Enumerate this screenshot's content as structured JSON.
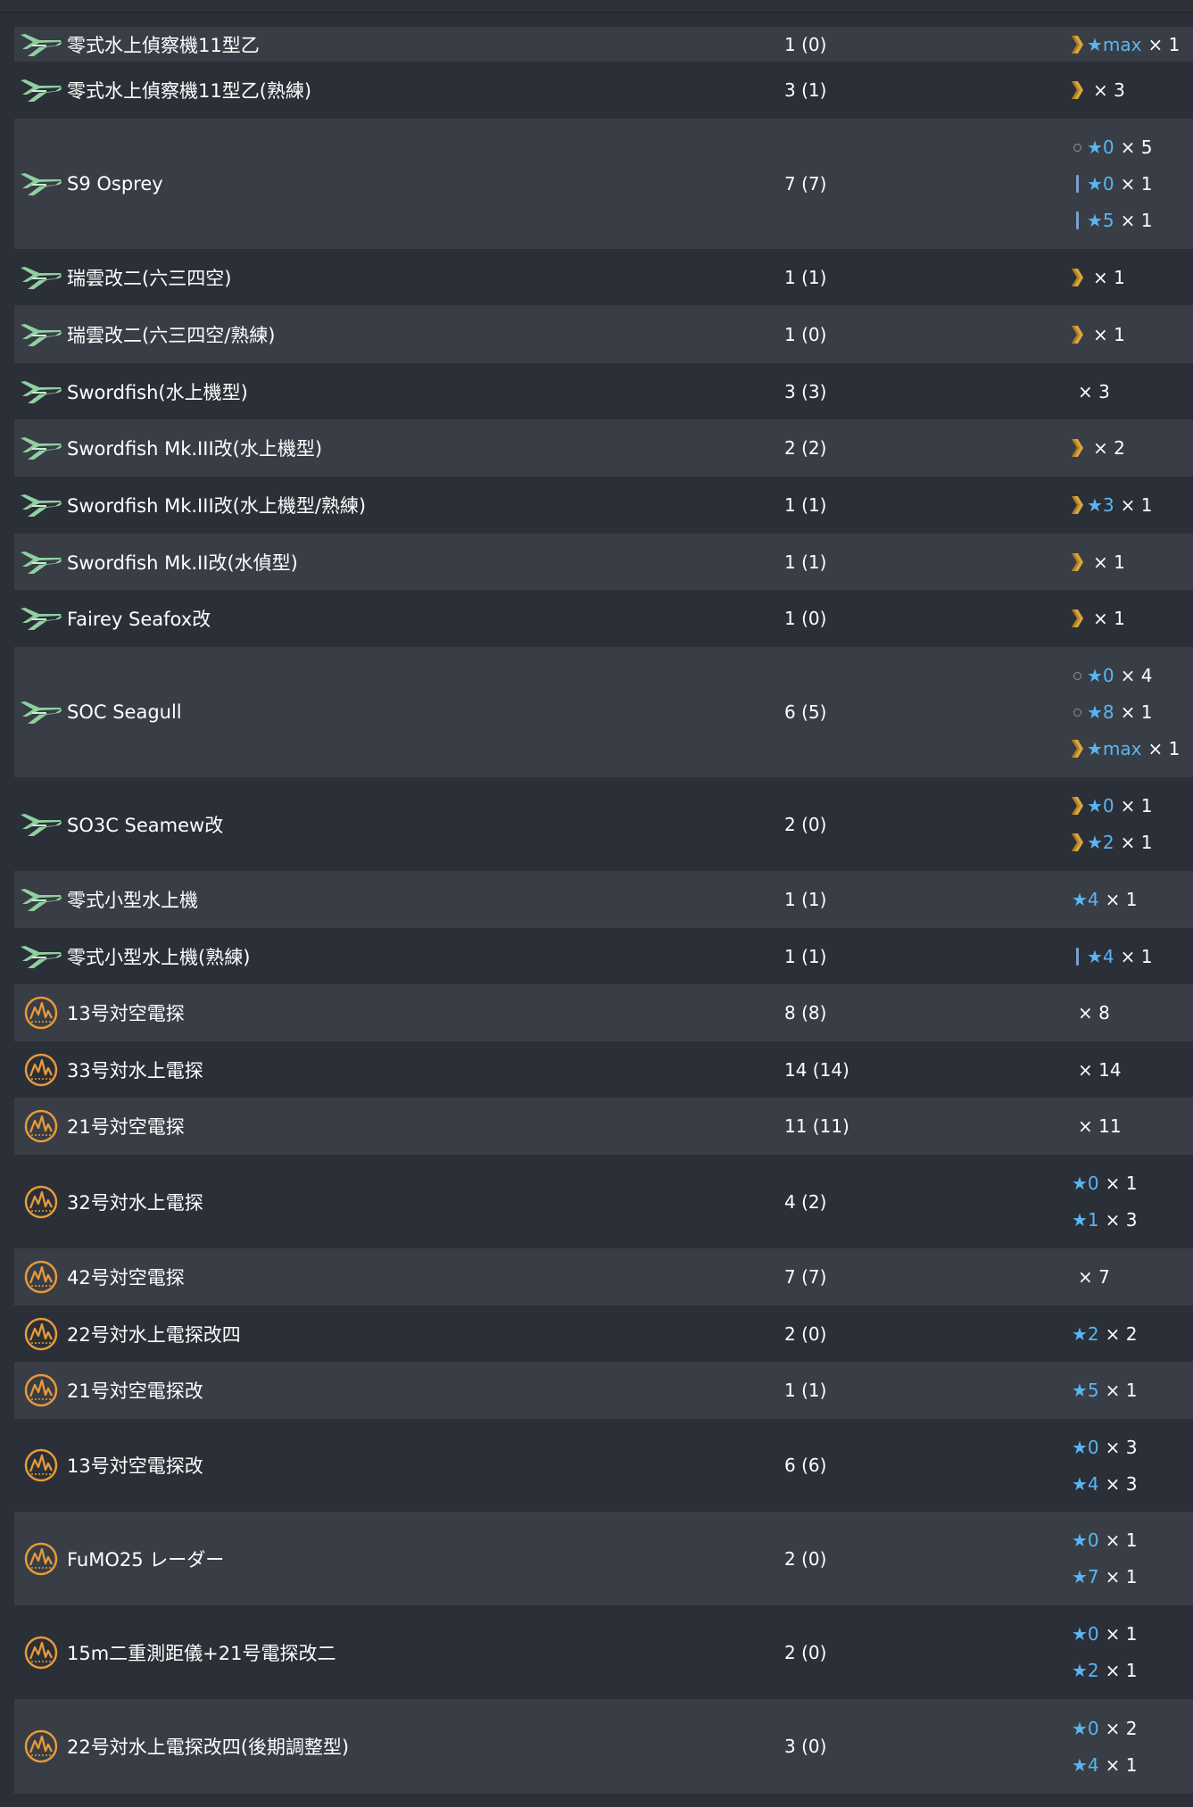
{
  "colors": {
    "background": "#2b2f37",
    "row_alt": "#393d45",
    "star": "#5ab6f2",
    "chevron": "#d9a640",
    "radar": "#e69a3a",
    "seaplane": "#8fd0a0"
  },
  "icons": {
    "seaplane": "seaplane-icon",
    "radar": "radar-icon",
    "chevron": "chevron-rank-icon",
    "ring": "ring-rank-icon",
    "bar": "bar-rank-icon"
  },
  "rows": [
    {
      "icon": "seaplane",
      "name": "零式水上偵察機11型乙",
      "count": "1 (0)",
      "h": 39,
      "prof": [
        {
          "mark": "chevron",
          "star": "★max",
          "mult": "× 1"
        }
      ]
    },
    {
      "icon": "seaplane",
      "name": "零式水上偵察機11型乙(熟練)",
      "count": "3 (1)",
      "h": 64,
      "prof": [
        {
          "mark": "chevron",
          "star": "",
          "mult": "× 3"
        }
      ]
    },
    {
      "icon": "seaplane",
      "name": "S9 Osprey",
      "count": "7 (7)",
      "h": 146,
      "prof": [
        {
          "mark": "ring",
          "star": "★0",
          "mult": "× 5"
        },
        {
          "mark": "bar",
          "star": "★0",
          "mult": "× 1"
        },
        {
          "mark": "bar",
          "star": "★5",
          "mult": "× 1"
        }
      ]
    },
    {
      "icon": "seaplane",
      "name": "瑞雲改二(六三四空)",
      "count": "1 (1)",
      "h": 63,
      "prof": [
        {
          "mark": "chevron",
          "star": "",
          "mult": "× 1"
        }
      ]
    },
    {
      "icon": "seaplane",
      "name": "瑞雲改二(六三四空/熟練)",
      "count": "1 (0)",
      "h": 65,
      "prof": [
        {
          "mark": "chevron",
          "star": "",
          "mult": "× 1"
        }
      ]
    },
    {
      "icon": "seaplane",
      "name": "Swordfish(水上機型)",
      "count": "3 (3)",
      "h": 63,
      "prof": [
        {
          "mark": "none",
          "star": "",
          "mult": "× 3"
        }
      ]
    },
    {
      "icon": "seaplane",
      "name": "Swordfish Mk.III改(水上機型)",
      "count": "2 (2)",
      "h": 64,
      "prof": [
        {
          "mark": "chevron",
          "star": "",
          "mult": "× 2"
        }
      ]
    },
    {
      "icon": "seaplane",
      "name": "Swordfish Mk.III改(水上機型/熟練)",
      "count": "1 (1)",
      "h": 64,
      "prof": [
        {
          "mark": "chevron",
          "star": "★3",
          "mult": "× 1"
        }
      ]
    },
    {
      "icon": "seaplane",
      "name": "Swordfish Mk.II改(水偵型)",
      "count": "1 (1)",
      "h": 63,
      "prof": [
        {
          "mark": "chevron",
          "star": "",
          "mult": "× 1"
        }
      ]
    },
    {
      "icon": "seaplane",
      "name": "Fairey Seafox改",
      "count": "1 (0)",
      "h": 64,
      "prof": [
        {
          "mark": "chevron",
          "star": "",
          "mult": "× 1"
        }
      ]
    },
    {
      "icon": "seaplane",
      "name": "SOC Seagull",
      "count": "6 (5)",
      "h": 146,
      "prof": [
        {
          "mark": "ring",
          "star": "★0",
          "mult": "× 4"
        },
        {
          "mark": "ring",
          "star": "★8",
          "mult": "× 1"
        },
        {
          "mark": "chevron",
          "star": "★max",
          "mult": "× 1"
        }
      ]
    },
    {
      "icon": "seaplane",
      "name": "SO3C Seamew改",
      "count": "2 (0)",
      "h": 105,
      "prof": [
        {
          "mark": "chevron",
          "star": "★0",
          "mult": "× 1"
        },
        {
          "mark": "chevron",
          "star": "★2",
          "mult": "× 1"
        }
      ]
    },
    {
      "icon": "seaplane",
      "name": "零式小型水上機",
      "count": "1 (1)",
      "h": 64,
      "prof": [
        {
          "mark": "none",
          "star": "★4",
          "mult": "× 1"
        }
      ]
    },
    {
      "icon": "seaplane",
      "name": "零式小型水上機(熟練)",
      "count": "1 (1)",
      "h": 63,
      "prof": [
        {
          "mark": "bar",
          "star": "★4",
          "mult": "× 1"
        }
      ]
    },
    {
      "icon": "radar",
      "name": "13号対空電探",
      "count": "8 (8)",
      "h": 64,
      "prof": [
        {
          "mark": "none",
          "star": "",
          "mult": "× 8"
        }
      ]
    },
    {
      "icon": "radar",
      "name": "33号対水上電探",
      "count": "14 (14)",
      "h": 63,
      "prof": [
        {
          "mark": "none",
          "star": "",
          "mult": "× 14"
        }
      ]
    },
    {
      "icon": "radar",
      "name": "21号対空電探",
      "count": "11 (11)",
      "h": 64,
      "prof": [
        {
          "mark": "none",
          "star": "",
          "mult": "× 11"
        }
      ]
    },
    {
      "icon": "radar",
      "name": "32号対水上電探",
      "count": "4 (2)",
      "h": 105,
      "prof": [
        {
          "mark": "none",
          "star": "★0",
          "mult": "× 1"
        },
        {
          "mark": "none",
          "star": "★1",
          "mult": "× 3"
        }
      ]
    },
    {
      "icon": "radar",
      "name": "42号対空電探",
      "count": "7 (7)",
      "h": 64,
      "prof": [
        {
          "mark": "none",
          "star": "",
          "mult": "× 7"
        }
      ]
    },
    {
      "icon": "radar",
      "name": "22号対水上電探改四",
      "count": "2 (0)",
      "h": 63,
      "prof": [
        {
          "mark": "none",
          "star": "★2",
          "mult": "× 2"
        }
      ]
    },
    {
      "icon": "radar",
      "name": "21号対空電探改",
      "count": "1 (1)",
      "h": 64,
      "prof": [
        {
          "mark": "none",
          "star": "★5",
          "mult": "× 1"
        }
      ]
    },
    {
      "icon": "radar",
      "name": "13号対空電探改",
      "count": "6 (6)",
      "h": 104,
      "prof": [
        {
          "mark": "none",
          "star": "★0",
          "mult": "× 3"
        },
        {
          "mark": "none",
          "star": "★4",
          "mult": "× 3"
        }
      ]
    },
    {
      "icon": "radar",
      "name": "FuMO25 レーダー",
      "count": "2 (0)",
      "h": 105,
      "prof": [
        {
          "mark": "none",
          "star": "★0",
          "mult": "× 1"
        },
        {
          "mark": "none",
          "star": "★7",
          "mult": "× 1"
        }
      ]
    },
    {
      "icon": "radar",
      "name": "15m二重測距儀+21号電探改二",
      "count": "2 (0)",
      "h": 105,
      "prof": [
        {
          "mark": "none",
          "star": "★0",
          "mult": "× 1"
        },
        {
          "mark": "none",
          "star": "★2",
          "mult": "× 1"
        }
      ]
    },
    {
      "icon": "radar",
      "name": "22号対水上電探改四(後期調整型)",
      "count": "3 (0)",
      "h": 106,
      "prof": [
        {
          "mark": "none",
          "star": "★0",
          "mult": "× 2"
        },
        {
          "mark": "none",
          "star": "★4",
          "mult": "× 1"
        }
      ]
    }
  ]
}
